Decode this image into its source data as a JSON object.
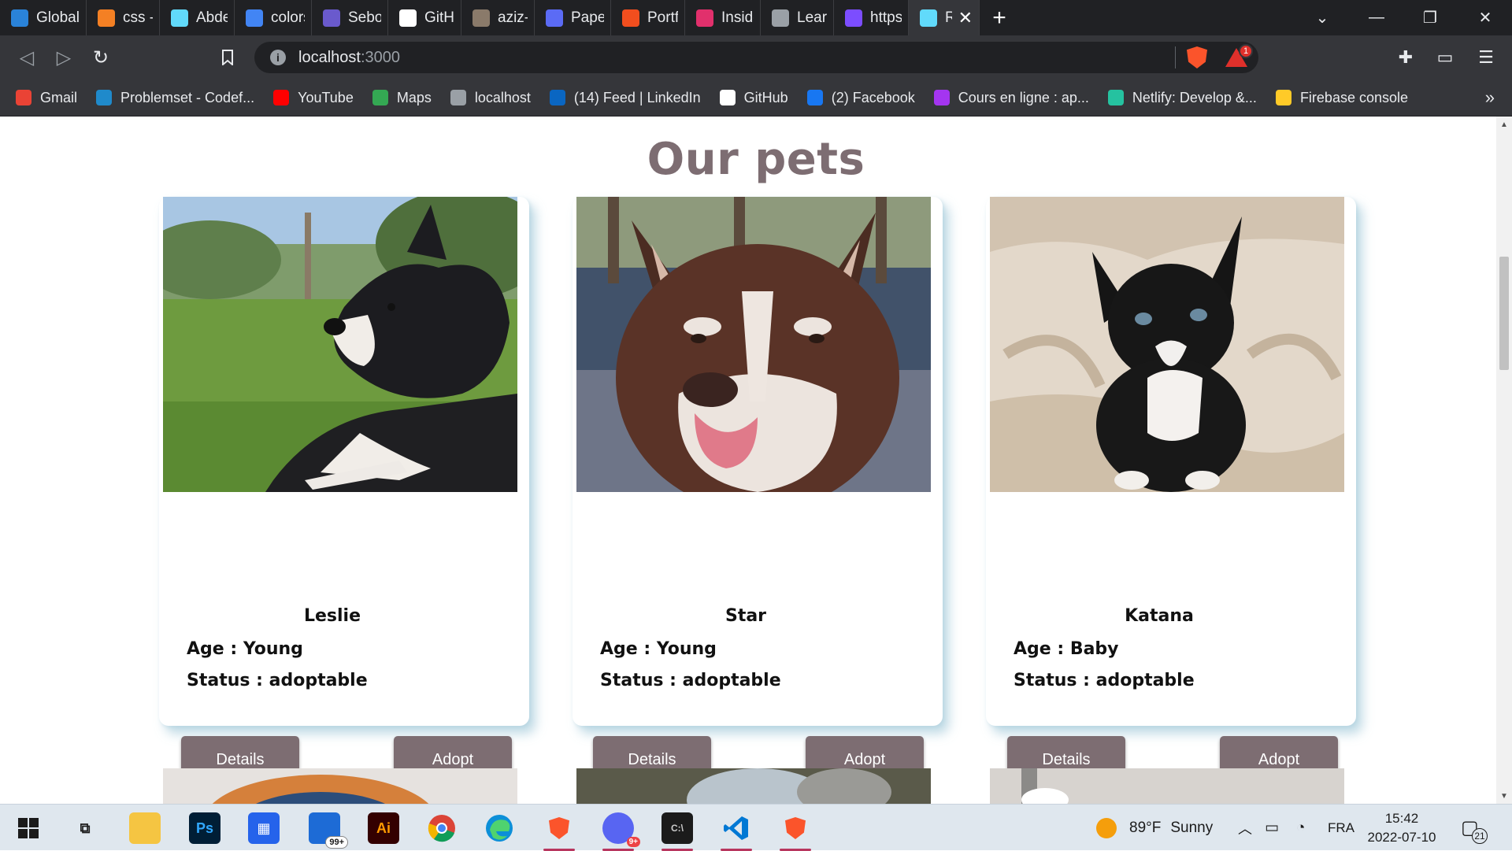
{
  "browser": {
    "tabs": [
      {
        "title": "Global c",
        "icon": "globe-icon",
        "color": "#2a83d9"
      },
      {
        "title": "css - Re",
        "icon": "stackoverflow-icon",
        "color": "#f48024"
      },
      {
        "title": "Abdelra",
        "icon": "react-icon",
        "color": "#61dafb"
      },
      {
        "title": "colorspi",
        "icon": "google-icon",
        "color": "#4285f4"
      },
      {
        "title": "Sebo St",
        "icon": "layers-icon",
        "color": "#6a5acd"
      },
      {
        "title": "GitHub",
        "icon": "github-icon",
        "color": "#ffffff"
      },
      {
        "title": "aziz-rba",
        "icon": "image-icon",
        "color": "#8a7a6a"
      },
      {
        "title": "Paperpi",
        "icon": "paperpillar-icon",
        "color": "#5b6bf5"
      },
      {
        "title": "Portfolic",
        "icon": "figma-icon",
        "color": "#f24e1e"
      },
      {
        "title": "Inside C",
        "icon": "instagram-icon",
        "color": "#e1306c"
      },
      {
        "title": "Learn U",
        "icon": "x-logo-icon",
        "color": "#9aa0a6"
      },
      {
        "title": "https://",
        "icon": "app-icon",
        "color": "#7c4dff"
      },
      {
        "title": "Rea",
        "icon": "react-icon",
        "color": "#61dafb"
      }
    ],
    "url_host": "localhost",
    "url_port": ":3000",
    "rewards_badge": "1",
    "bookmarks": [
      {
        "label": "Gmail",
        "icon": "gmail-icon",
        "color": "#ea4335"
      },
      {
        "label": "Problemset - Codef...",
        "icon": "codeforces-icon",
        "color": "#1f8acb"
      },
      {
        "label": "YouTube",
        "icon": "youtube-icon",
        "color": "#ff0000"
      },
      {
        "label": "Maps",
        "icon": "maps-icon",
        "color": "#34a853"
      },
      {
        "label": "localhost",
        "icon": "globe-icon",
        "color": "#9aa0a6"
      },
      {
        "label": "(14) Feed | LinkedIn",
        "icon": "linkedin-icon",
        "color": "#0a66c2"
      },
      {
        "label": "GitHub",
        "icon": "github-icon",
        "color": "#ffffff"
      },
      {
        "label": "(2) Facebook",
        "icon": "facebook-icon",
        "color": "#1877f2"
      },
      {
        "label": "Cours en ligne : ap...",
        "icon": "udemy-icon",
        "color": "#a435f0"
      },
      {
        "label": "Netlify: Develop &...",
        "icon": "netlify-icon",
        "color": "#25c2a0"
      },
      {
        "label": "Firebase console",
        "icon": "firebase-icon",
        "color": "#ffca28"
      }
    ]
  },
  "page": {
    "title": "Our pets",
    "pets": [
      {
        "name": "Leslie",
        "age_label": "Age : ",
        "age": "Young",
        "status_label": "Status : ",
        "status": "adoptable",
        "details": "Details",
        "adopt": "Adopt"
      },
      {
        "name": "Star",
        "age_label": "Age : ",
        "age": "Young",
        "status_label": "Status : ",
        "status": "adoptable",
        "details": "Details",
        "adopt": "Adopt"
      },
      {
        "name": "Katana",
        "age_label": "Age : ",
        "age": "Baby",
        "status_label": "Status : ",
        "status": "adoptable",
        "details": "Details",
        "adopt": "Adopt"
      }
    ],
    "accent_color": "#7d6d72"
  },
  "taskbar": {
    "weather_temp": "89°F",
    "weather_text": "Sunny",
    "language": "FRA",
    "time": "15:42",
    "date": "2022-07-10",
    "notifications": "21",
    "mail_badge": "99+",
    "discord_badge": "9+"
  }
}
